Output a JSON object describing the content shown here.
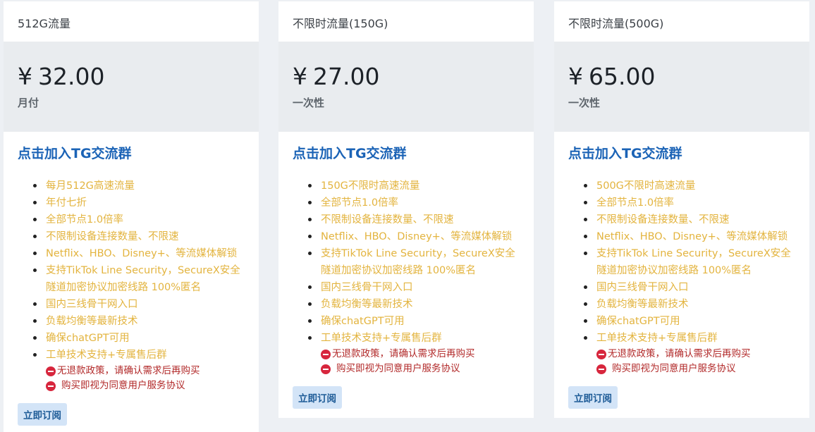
{
  "plans": [
    {
      "name": "512G流量",
      "currency": "¥",
      "price": "32.00",
      "cycle": "月付",
      "tg_link": "点击加入TG交流群",
      "features": [
        "每月512G高速流量",
        "年付七折",
        "全部节点1.0倍率",
        "不限制设备连接数量、不限速",
        "Netflix、HBO、Disney+、等流媒体解锁",
        [
          "支持TikTok Line Security，SecureX安全",
          "隧道加密协议加密线路 100%匿名"
        ],
        "国内三线骨干网入口",
        "负载均衡等最新技术",
        "确保chatGPT可用",
        "工单技术支持+专属售后群"
      ],
      "notes": [
        "无退款政策，请确认需求后再购买",
        "购买即视为同意用户服务协议"
      ],
      "button": "立即订阅"
    },
    {
      "name": "不限时流量(150G)",
      "currency": "¥",
      "price": "27.00",
      "cycle": "一次性",
      "tg_link": "点击加入TG交流群",
      "features": [
        "150G不限时高速流量",
        "全部节点1.0倍率",
        "不限制设备连接数量、不限速",
        "Netflix、HBO、Disney+、等流媒体解锁",
        [
          "支持TikTok Line Security，SecureX安全",
          "隧道加密协议加密线路 100%匿名"
        ],
        "国内三线骨干网入口",
        "负载均衡等最新技术",
        "确保chatGPT可用",
        "工单技术支持+专属售后群"
      ],
      "notes": [
        "无退款政策，请确认需求后再购买",
        "购买即视为同意用户服务协议"
      ],
      "button": "立即订阅"
    },
    {
      "name": "不限时流量(500G)",
      "currency": "¥",
      "price": "65.00",
      "cycle": "一次性",
      "tg_link": "点击加入TG交流群",
      "features": [
        "500G不限时高速流量",
        "全部节点1.0倍率",
        "不限制设备连接数量、不限速",
        "Netflix、HBO、Disney+、等流媒体解锁",
        [
          "支持TikTok Line Security，SecureX安全",
          "隧道加密协议加密线路 100%匿名"
        ],
        "国内三线骨干网入口",
        "负载均衡等最新技术",
        "确保chatGPT可用",
        "工单技术支持+专属售后群"
      ],
      "notes": [
        "无退款政策，请确认需求后再购买",
        "购买即视为同意用户服务协议"
      ],
      "button": "立即订阅"
    }
  ],
  "icons": {
    "note": "no-entry-icon",
    "bullet": "bullet-dot"
  },
  "colors": {
    "feature_text": "#e3b43f",
    "link": "#1b63b6",
    "note_text": "#b22a2a",
    "price_bg": "#e9ecef",
    "button_bg": "#d3e4f7"
  }
}
